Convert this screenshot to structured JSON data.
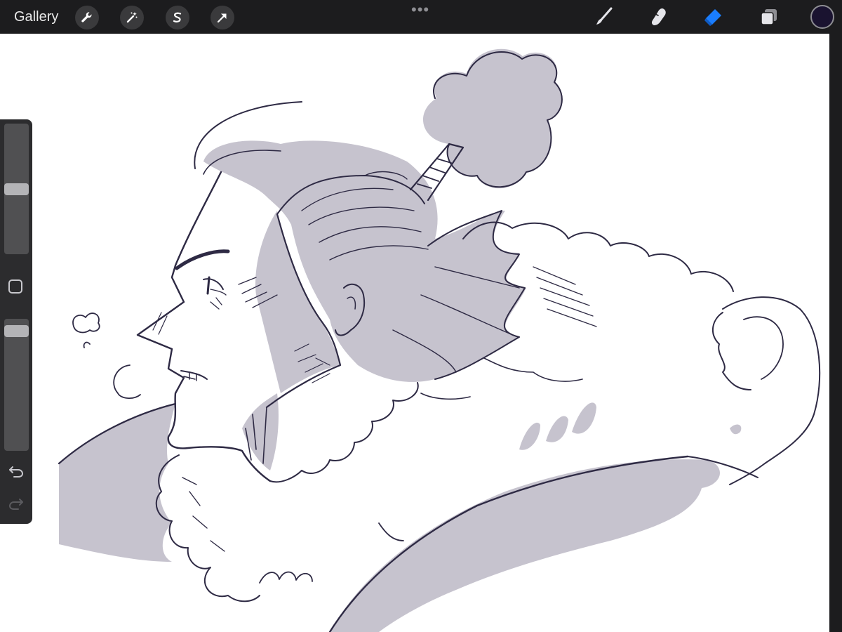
{
  "topbar": {
    "gallery_label": "Gallery",
    "left_tools": [
      "actions-wrench",
      "adjustments-wand",
      "selection-s",
      "transform-arrow"
    ],
    "more_dots": "•••",
    "right_tools": [
      "brush",
      "smudge",
      "eraser",
      "layers"
    ],
    "active_tool": "eraser",
    "active_tool_color": "#1a7dff",
    "current_color": "#1a1330"
  },
  "sidebar": {
    "brush_size_level": 0.5,
    "opacity_level": 0.95
  },
  "canvas": {
    "ink_color": "#2e2a44",
    "shade_color": "#c6c3ce"
  }
}
